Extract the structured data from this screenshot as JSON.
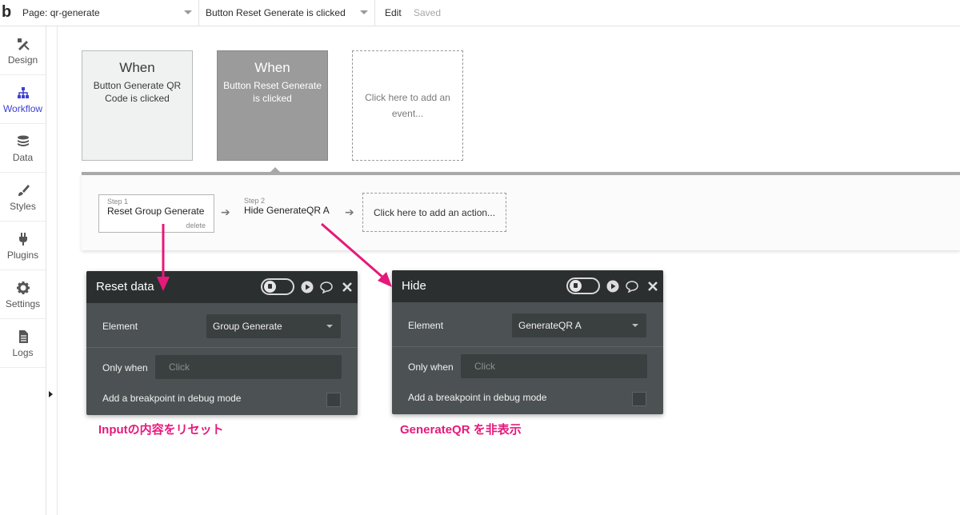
{
  "topbar": {
    "logo": "b",
    "page_label": "Page: qr-generate",
    "event_label": "Button Reset Generate is clicked",
    "edit": "Edit",
    "saved": "Saved"
  },
  "sidebar": {
    "items": [
      {
        "label": "Design",
        "icon": "design-icon"
      },
      {
        "label": "Workflow",
        "icon": "workflow-icon"
      },
      {
        "label": "Data",
        "icon": "data-icon"
      },
      {
        "label": "Styles",
        "icon": "brush-icon"
      },
      {
        "label": "Plugins",
        "icon": "plug-icon"
      },
      {
        "label": "Settings",
        "icon": "gear-icon"
      },
      {
        "label": "Logs",
        "icon": "document-icon"
      }
    ]
  },
  "events": [
    {
      "when": "When",
      "desc": "Button Generate QR Code is clicked"
    },
    {
      "when": "When",
      "desc": "Button Reset Generate is clicked"
    },
    {
      "add": "Click here to add an event..."
    }
  ],
  "steps": {
    "step1_label": "Step 1",
    "step1_name": "Reset Group Generate",
    "step1_delete": "delete",
    "step2_label": "Step 2",
    "step2_name": "Hide GenerateQR A",
    "add_action": "Click here to add an action..."
  },
  "panel_reset": {
    "title": "Reset data",
    "element_label": "Element",
    "element_value": "Group Generate",
    "only_when_label": "Only when",
    "only_when_placeholder": "Click",
    "breakpoint_label": "Add a breakpoint in debug mode"
  },
  "panel_hide": {
    "title": "Hide",
    "element_label": "Element",
    "element_value": "GenerateQR A",
    "only_when_label": "Only when",
    "only_when_placeholder": "Click",
    "breakpoint_label": "Add a breakpoint in debug mode"
  },
  "annotations": {
    "note1": "Inputの内容をリセット",
    "note2": "GenerateQR を非表示",
    "color": "#e6197a"
  }
}
